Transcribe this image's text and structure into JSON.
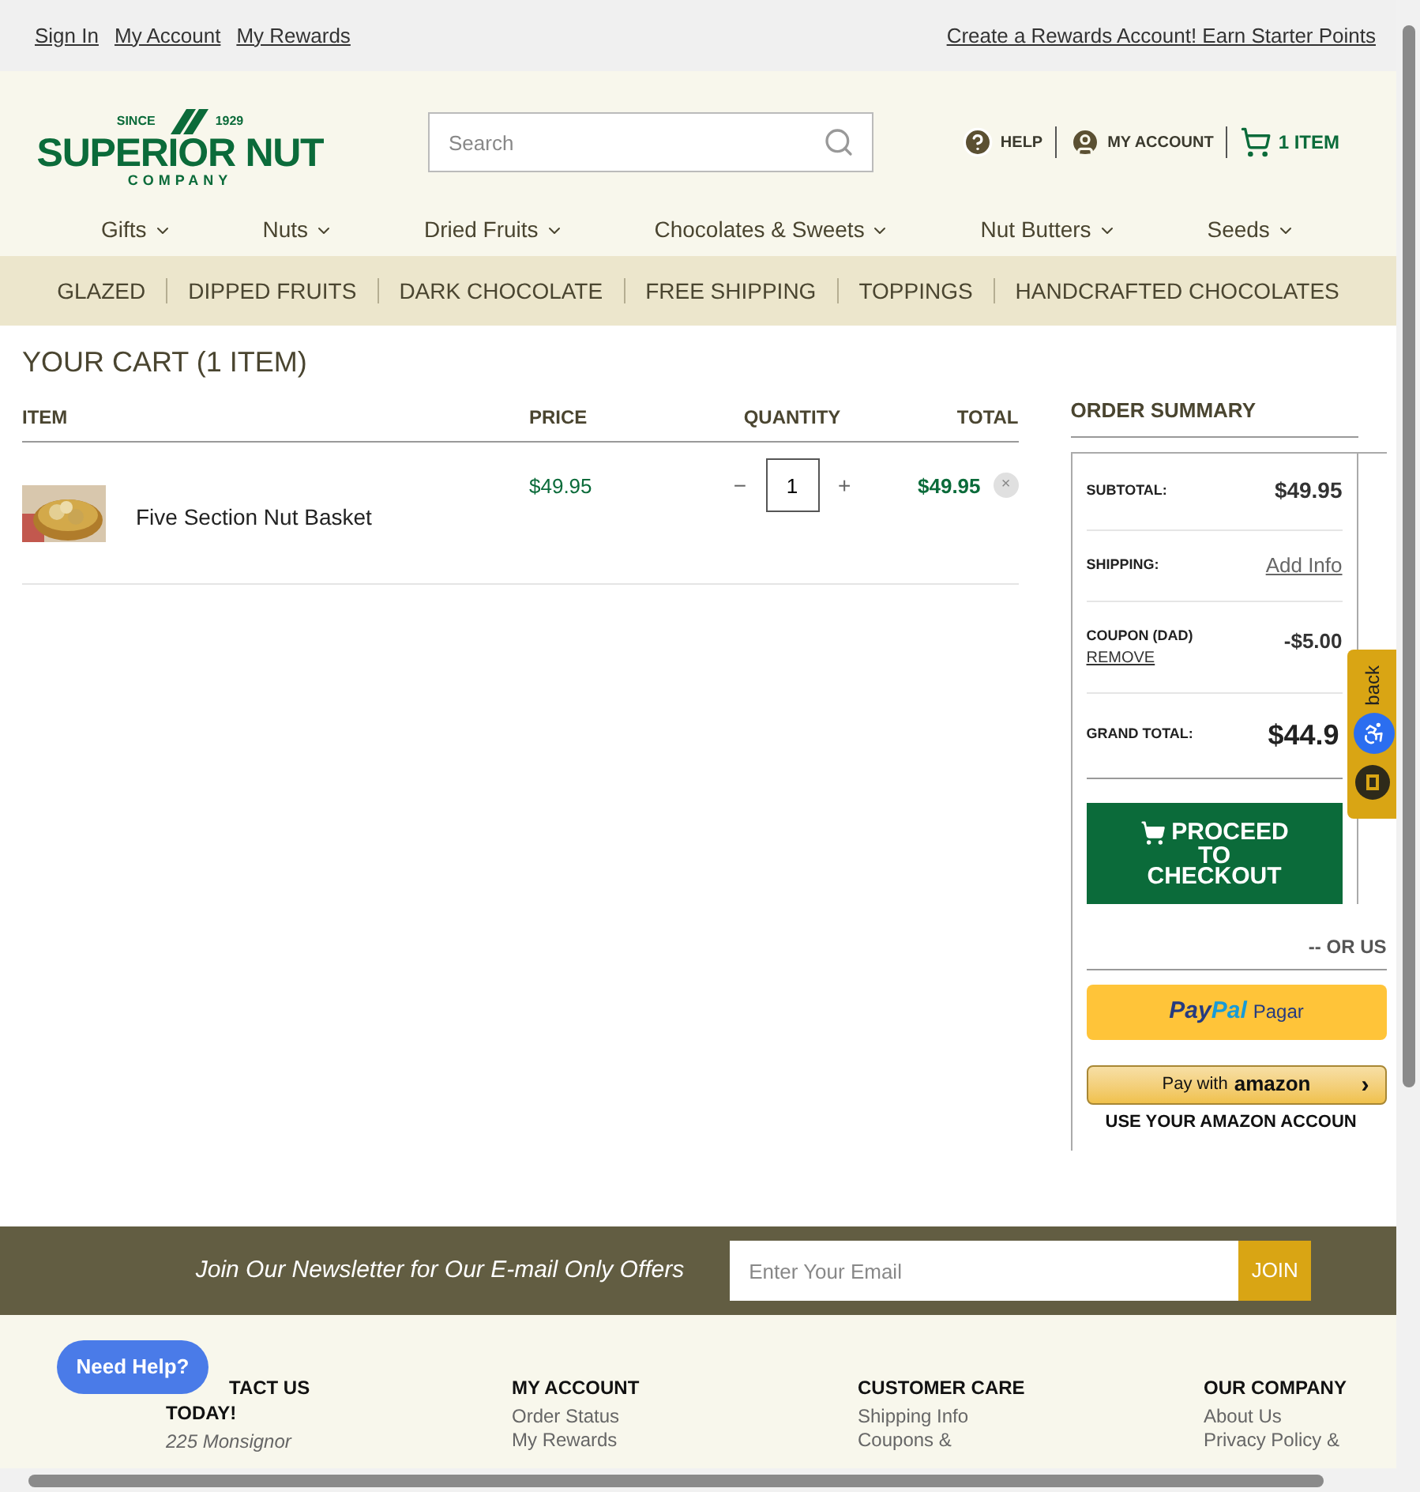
{
  "top_bar": {
    "links": [
      "Sign In",
      "My Account",
      "My Rewards"
    ],
    "promo": "Create a Rewards Account! Earn Starter Points"
  },
  "logo": {
    "since": "SINCE",
    "year": "1929",
    "name": "SUPERIOR NUT",
    "sub": "COMPANY"
  },
  "search": {
    "placeholder": "Search"
  },
  "header_links": [
    {
      "kind": "help",
      "label": "HELP"
    },
    {
      "kind": "account",
      "label": "MY ACCOUNT"
    },
    {
      "kind": "cart",
      "label": "1 ITEM"
    }
  ],
  "main_nav": [
    "Gifts",
    "Nuts",
    "Dried Fruits",
    "Chocolates & Sweets",
    "Nut Butters",
    "Seeds"
  ],
  "sub_nav": [
    "GLAZED",
    "DIPPED FRUITS",
    "DARK CHOCOLATE",
    "FREE SHIPPING",
    "TOPPINGS",
    "HANDCRAFTED CHOCOLATES"
  ],
  "cart": {
    "title": "YOUR CART (1 ITEM)",
    "columns": [
      "ITEM",
      "PRICE",
      "QUANTITY",
      "TOTAL"
    ],
    "rows": [
      {
        "name": "Five Section Nut Basket",
        "price": "$49.95",
        "minus": "−",
        "quantity": "1",
        "plus": "+",
        "total": "$49.95",
        "remove": "×"
      }
    ]
  },
  "summary": {
    "title": "ORDER SUMMARY",
    "subtotal_label": "SUBTOTAL:",
    "subtotal": "$49.95",
    "shipping_label": "SHIPPING:",
    "shipping": "Add Info",
    "coupon_label": "COUPON (DAD)",
    "coupon_remove": "REMOVE",
    "coupon": "-$5.00",
    "grand_label": "GRAND TOTAL:",
    "grand": "$44.9",
    "checkout": [
      "PROCEED",
      "TO",
      "CHECKOUT"
    ],
    "or_use": "-- OR US",
    "paypal": {
      "pay": "Pay",
      "pal": "Pal",
      "action": "Pagar"
    },
    "amazon": {
      "pay_with": "Pay with",
      "brand": "amazon",
      "arrow": "›"
    },
    "amazon_note": "USE YOUR AMAZON ACCOUN"
  },
  "feedback": {
    "label": "back"
  },
  "newsletter": {
    "text": "Join Our Newsletter for Our E-mail Only Offers",
    "placeholder": "Enter Your Email",
    "button": "JOIN"
  },
  "need_help": "Need Help?",
  "footer": [
    {
      "title": [
        "TACT US",
        "TODAY!"
      ],
      "items": [
        "225 Monsignor"
      ],
      "italic": true
    },
    {
      "title": [
        "MY ACCOUNT"
      ],
      "items": [
        "Order Status",
        "My Rewards"
      ],
      "italic": false
    },
    {
      "title": [
        "CUSTOMER CARE"
      ],
      "items": [
        "Shipping Info",
        "Coupons &"
      ],
      "italic": false
    },
    {
      "title": [
        "OUR COMPANY"
      ],
      "items": [
        "About Us",
        "Privacy Policy &"
      ],
      "italic": false
    }
  ]
}
